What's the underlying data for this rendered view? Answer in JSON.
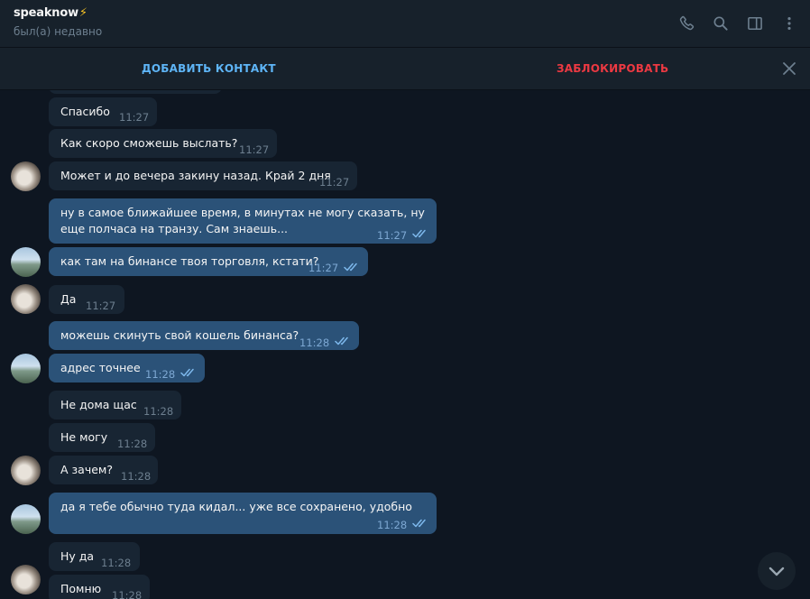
{
  "header": {
    "name": "speaknow",
    "emoji": "⚡",
    "status": "был(а) недавно"
  },
  "actions": {
    "add_contact": "ДОБАВИТЬ КОНТАКТ",
    "block": "ЗАБЛОКИРОВАТЬ"
  },
  "icons": {
    "call": "phone-icon",
    "search": "search-icon",
    "sidebar": "sidebar-toggle-icon",
    "menu": "more-vertical-icon",
    "close": "close-icon",
    "scroll": "chevron-down-icon"
  },
  "colors": {
    "background": "#0e1621",
    "header": "#17212b",
    "incoming": "#182533",
    "outgoing": "#2b5278",
    "accent": "#5eb5f7",
    "danger": "#ec3942"
  },
  "messages": [
    {
      "dir": "in",
      "text": "Спасибо",
      "time": "11:27"
    },
    {
      "dir": "in",
      "text": "Как скоро сможешь выслать?",
      "time": "11:27"
    },
    {
      "dir": "in",
      "text": "Может и до вечера закину назад. Край 2 дня",
      "time": "11:27"
    },
    {
      "dir": "out",
      "text": "ну в самое ближайшее время, в минутах не могу сказать, ну еще полчаса на транзу. Сам знаешь...",
      "time": "11:27",
      "read": true
    },
    {
      "dir": "out",
      "text": "как там на бинансе твоя торговля, кстати?",
      "time": "11:27",
      "read": true
    },
    {
      "dir": "in",
      "text": "Да",
      "time": "11:27"
    },
    {
      "dir": "out",
      "text": "можешь скинуть свой кошель бинанса?",
      "time": "11:28",
      "read": true
    },
    {
      "dir": "out",
      "text": "адрес точнее",
      "time": "11:28",
      "read": true
    },
    {
      "dir": "in",
      "text": "Не дома щас",
      "time": "11:28"
    },
    {
      "dir": "in",
      "text": "Не могу",
      "time": "11:28"
    },
    {
      "dir": "in",
      "text": "А зачем?",
      "time": "11:28"
    },
    {
      "dir": "out",
      "text": "да я тебе обычно туда кидал... уже все сохранено, удобно",
      "time": "11:28",
      "read": true
    },
    {
      "dir": "in",
      "text": "Ну да",
      "time": "11:28"
    },
    {
      "dir": "in",
      "text": "Помню",
      "time": "11:28"
    }
  ]
}
